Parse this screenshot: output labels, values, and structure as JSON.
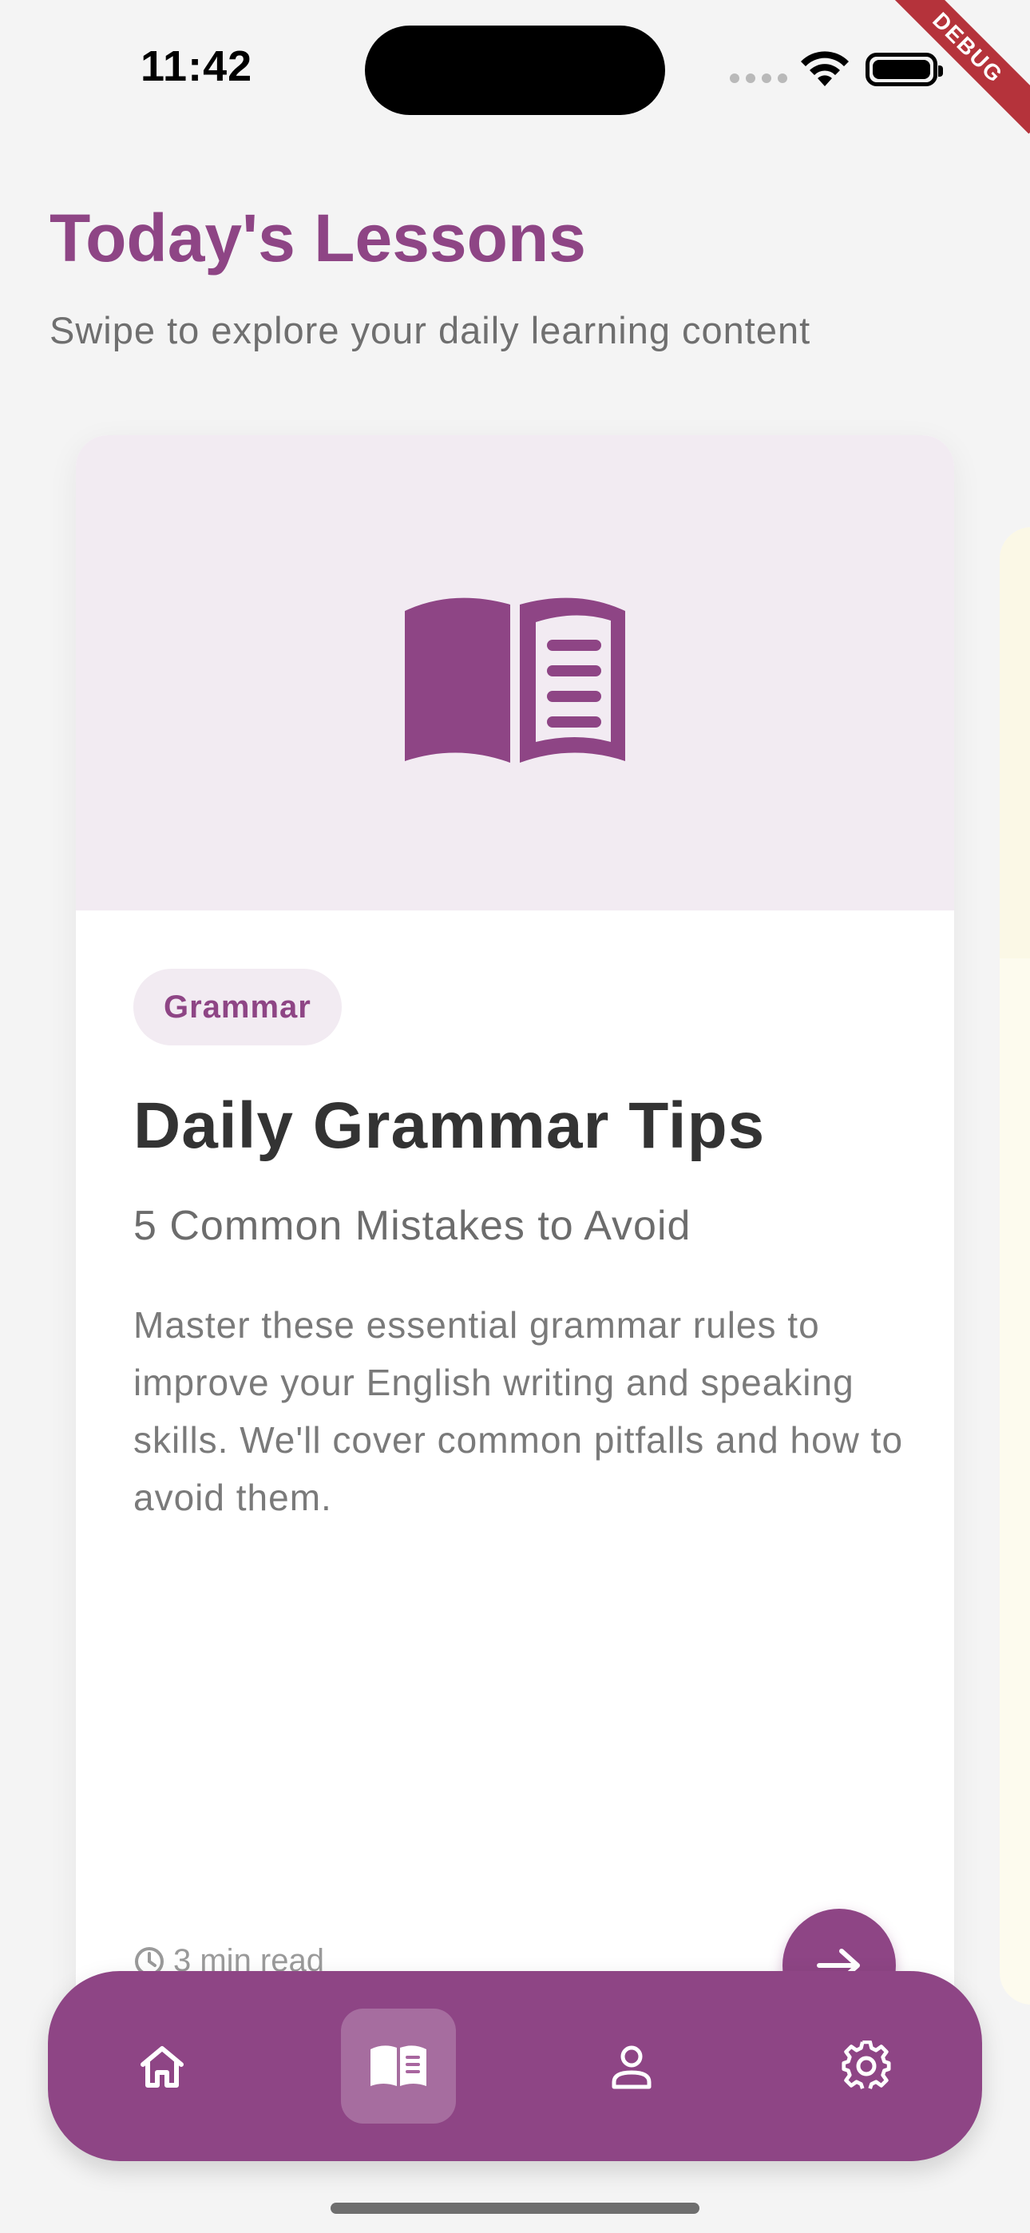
{
  "status_bar": {
    "time": "11:42",
    "debug_label": "DEBUG"
  },
  "header": {
    "title": "Today's Lessons",
    "subtitle": "Swipe to explore your daily learning content"
  },
  "lesson_card": {
    "hero_icon": "open-book-icon",
    "category": "Grammar",
    "title": "Daily Grammar Tips",
    "subtitle": "5 Common Mistakes to Avoid",
    "description": "Master these essential grammar rules to improve your English writing and speaking skills. We'll cover common pitfalls and how to avoid them.",
    "read_time": "3 min read",
    "next_icon": "arrow-right-icon"
  },
  "bottom_nav": {
    "items": [
      {
        "name": "home",
        "icon": "home-icon",
        "active": false
      },
      {
        "name": "lessons",
        "icon": "book-icon",
        "active": true
      },
      {
        "name": "profile",
        "icon": "person-icon",
        "active": false
      },
      {
        "name": "settings",
        "icon": "gear-icon",
        "active": false
      }
    ]
  },
  "colors": {
    "primary": "#8e4585",
    "hero_background": "#f2ebf2",
    "page_background": "#f4f4f4",
    "debug_ribbon": "#b5333b"
  }
}
